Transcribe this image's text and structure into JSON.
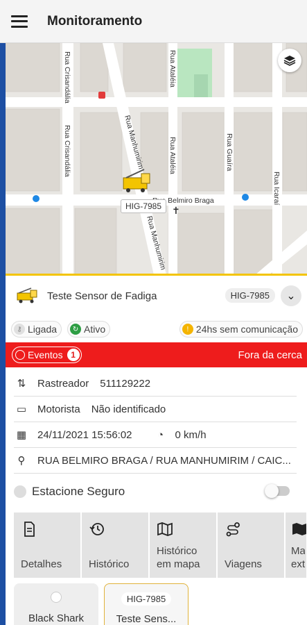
{
  "app": {
    "title": "Monitoramento"
  },
  "map": {
    "streets": [
      "Rua Crisandália",
      "Rua Crisandália",
      "Rua Manhumirim",
      "Rua Manhumirim",
      "Rua Ataléia",
      "Rua Ataléia",
      "Rua Guaíra",
      "Rua Icaraí",
      "Rua Belmiro Braga"
    ],
    "vehicle_plate_tag": "HIG-7985"
  },
  "vehicle": {
    "name": "Teste Sensor de Fadiga",
    "plate": "HIG-7985"
  },
  "status": {
    "ignition": "Ligada",
    "state": "Ativo",
    "communication": "24hs sem comunicação"
  },
  "events": {
    "label": "Eventos",
    "count": "1",
    "alert": "Fora da cerca"
  },
  "details": {
    "tracker_label": "Rastreador",
    "tracker_value": "511129222",
    "driver_label": "Motorista",
    "driver_value": "Não identificado",
    "datetime": "24/11/2021 15:56:02",
    "speed": "0 km/h",
    "address": "RUA BELMIRO BRAGA / RUA MANHUMIRIM / CAIC..."
  },
  "safe_parking": {
    "label": "Estacione Seguro",
    "enabled": false
  },
  "actions": [
    {
      "label": "Detalhes",
      "icon": "document-icon"
    },
    {
      "label": "Histórico",
      "icon": "history-icon"
    },
    {
      "label": "Histórico em mapa",
      "icon": "map-icon"
    },
    {
      "label": "Viagens",
      "icon": "route-icon"
    },
    {
      "label": "Ma ext",
      "icon": "map-extra-icon"
    }
  ],
  "vehicle_cards": [
    {
      "plate": "",
      "name": "Black Shark"
    },
    {
      "plate": "HIG-7985",
      "name": "Teste Sens..."
    }
  ],
  "colors": {
    "accent_blue": "#1d4fa3",
    "alert_red": "#ee1c1c",
    "vehicle_yellow": "#f3c400"
  }
}
